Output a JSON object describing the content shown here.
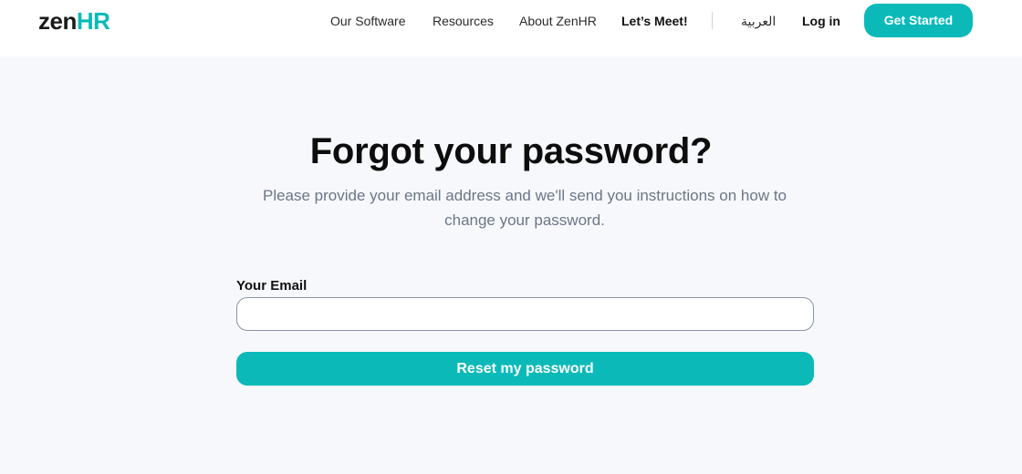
{
  "header": {
    "logo": {
      "zen": "zen",
      "hr": "HR"
    },
    "nav": {
      "our_software": "Our Software",
      "resources": "Resources",
      "about": "About ZenHR",
      "lets_meet": "Let’s Meet!",
      "arabic": "العربية",
      "login": "Log in"
    },
    "cta_label": "Get Started"
  },
  "main": {
    "title": "Forgot your password?",
    "subtitle": "Please provide your email address and we'll send you instructions on how to change your password.",
    "email_label": "Your Email",
    "email_value": "",
    "email_placeholder": "",
    "reset_label": "Reset my password"
  },
  "colors": {
    "accent": "#0bbab8",
    "background": "#f7f8fc",
    "text_muted": "#6b7688"
  }
}
